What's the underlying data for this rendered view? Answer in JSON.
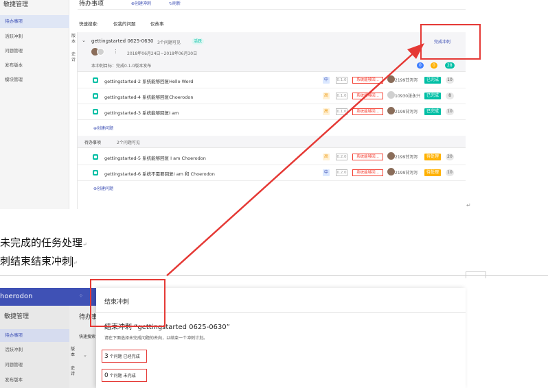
{
  "top_ui": {
    "app_title": "敏捷管理",
    "nav_items": [
      "待办事项",
      "活跃冲刺",
      "问题管理",
      "发布版本",
      "模块管理"
    ],
    "side_tabs": {
      "version": [
        "版",
        "本"
      ],
      "epic": [
        "史",
        "诗"
      ]
    },
    "page_title": "待办事项",
    "header_buttons": {
      "create_sprint": "创建冲刺",
      "refresh": "刷新"
    },
    "filters": {
      "label": "快速搜索:",
      "my_issues": "仅我的问题",
      "stories": "仅故事"
    },
    "sprint": {
      "name": "gettingstarted 0625-0630",
      "issue_count": "3个问题可见",
      "status": "活跃",
      "dates": "2018年06月24日~2018年06月30日",
      "goal": "本冲刺目标：完成0.1.0版本发布",
      "complete_button": "完成冲刺",
      "badges": [
        "0",
        "0",
        "28"
      ]
    },
    "sprint_rows": [
      {
        "title": "gettingstarted-2 系统能够回复Hello Word",
        "priority": "中",
        "version": "0.1.0",
        "tag": "系统能够回...",
        "assignee": "2199甘泻泻",
        "status": "已完成",
        "points": "10"
      },
      {
        "title": "gettingstarted-4 系统能够回复Choerodon",
        "priority": "高",
        "version": "0.1.0",
        "tag": "系统能够回...",
        "assignee": "10930张永兴",
        "status": "已完成",
        "points": "8"
      },
      {
        "title": "gettingstarted-3 系统能够回复I am",
        "priority": "高",
        "version": "0.1.0",
        "tag": "系统能够回...",
        "assignee": "2199甘泻泻",
        "status": "已完成",
        "points": "10"
      }
    ],
    "create_issue": "创建问题",
    "backlog": {
      "title": "待办事项",
      "count": "2个问题可见"
    },
    "backlog_rows": [
      {
        "title": "gettingstarted-5 系统能够回复 I am Choerodon",
        "priority": "高",
        "version": "0.2.0",
        "tag": "系统能够回...",
        "assignee": "2199甘泻泻",
        "status": "待处理",
        "points": "20"
      },
      {
        "title": "gettingstarted-6 系统不需要回复I am 和 Choerodon",
        "priority": "中",
        "version": "0.2.0",
        "tag": "系统能够回...",
        "assignee": "2199甘泻泻",
        "status": "待处理",
        "points": "10"
      }
    ]
  },
  "doc_text": {
    "line1": "未完成的任务处理",
    "line2": "刺结束结束冲刺",
    "para_mark": "↵"
  },
  "bottom_ui": {
    "brand": "hoerodon",
    "app_title": "敏捷管理",
    "page_title": "待办事项",
    "nav_items": [
      "待办事项",
      "活跃冲刺",
      "问题管理",
      "发布版本"
    ],
    "quick_search": "快速搜索",
    "dialog": {
      "title": "结束冲刺",
      "heading": "结束冲刺 “gettingstarted 0625-0630”",
      "description": "请在下面选择未完成问题的去向，以结束一个冲刺计划。",
      "done_count": "3",
      "done_label": "个问题 已经完成",
      "undone_count": "0",
      "undone_label": "个问题 未完成"
    }
  },
  "colors": {
    "primary": "#3f51b5",
    "success": "#00bfa5",
    "warning": "#ffb100",
    "danger": "#f44336",
    "annotation": "#e53935"
  }
}
